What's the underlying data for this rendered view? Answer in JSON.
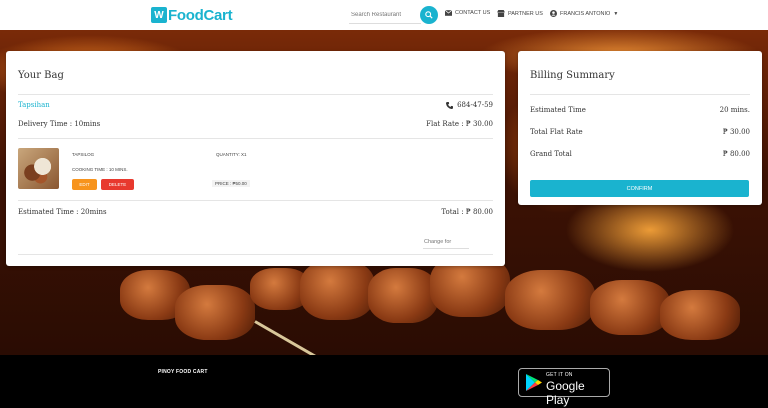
{
  "header": {
    "logo_text": "FoodCart",
    "logo_mark": "W",
    "search_placeholder": "Search Restaurant",
    "nav": [
      {
        "label": "CONTACT US",
        "icon": "mail-icon"
      },
      {
        "label": "PARTNER US",
        "icon": "store-icon"
      },
      {
        "label": "FRANCIS ANTONIO",
        "icon": "account-icon"
      }
    ]
  },
  "bag": {
    "title": "Your Bag",
    "restaurant": "Tapsihan",
    "phone": "684-47-59",
    "delivery_time": "Delivery Time : 10mins",
    "flat_rate": "Flat Rate : ₱ 30.00",
    "item": {
      "name": "TAPSILOG",
      "quantity": "QUANTITY: X1",
      "cooking_time": "COOKING TIME : 10 MINS.",
      "price": "PRICE : ₱50.00",
      "edit_label": "EDIT",
      "delete_label": "DELETE"
    },
    "estimated_time": "Estimated Time : 20mins",
    "total": "Total : ₱ 80.00",
    "change_placeholder": "Change for"
  },
  "billing": {
    "title": "Billing Summary",
    "rows": [
      {
        "label": "Estimated Time",
        "value": "20 mins."
      },
      {
        "label": "Total Flat Rate",
        "value": "₱ 30.00"
      },
      {
        "label": "Grand Total",
        "value": "₱ 80.00"
      }
    ],
    "confirm_label": "CONFIRM"
  },
  "footer": {
    "title": "PINOY FOOD CART",
    "store_small": "GET IT ON",
    "store_big": "Google Play"
  },
  "colors": {
    "accent": "#1ab3cf",
    "edit": "#f7941d",
    "delete": "#e8392e"
  }
}
